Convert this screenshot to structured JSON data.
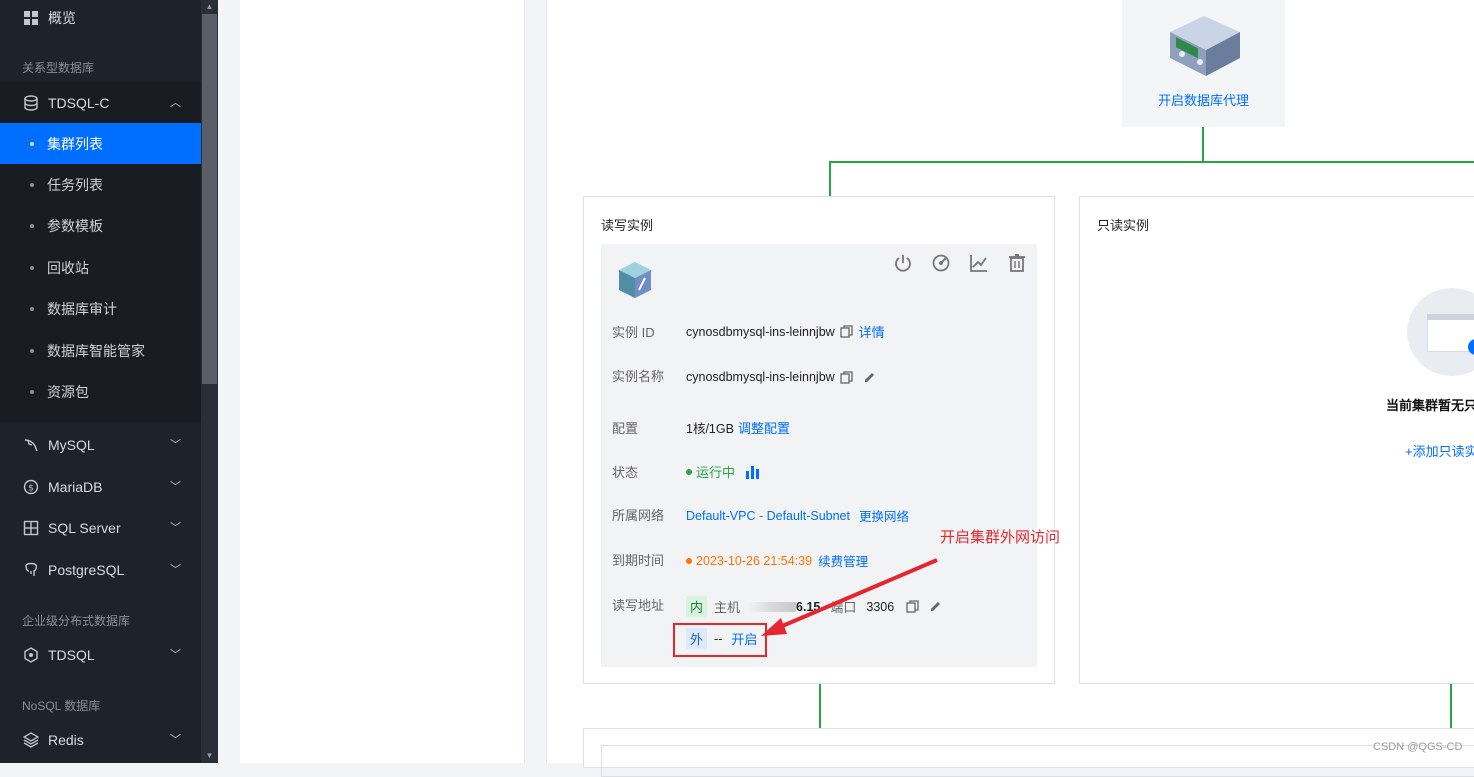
{
  "sidebar": {
    "overview": "概览",
    "section_relational": "关系型数据库",
    "tdsqlc": "TDSQL-C",
    "tdsqlc_items": [
      "集群列表",
      "任务列表",
      "参数模板",
      "回收站",
      "数据库审计",
      "数据库智能管家",
      "资源包"
    ],
    "mysql": "MySQL",
    "mariadb": "MariaDB",
    "sqlserver": "SQL Server",
    "postgresql": "PostgreSQL",
    "section_enterprise": "企业级分布式数据库",
    "tdsql": "TDSQL",
    "section_nosql": "NoSQL 数据库",
    "redis": "Redis"
  },
  "proxy": {
    "label": "开启数据库代理"
  },
  "rw": {
    "title": "读写实例",
    "id_label": "实例 ID",
    "id_value": "cynosdbmysql-ins-leinnjbw",
    "details_link": "详情",
    "name_label": "实例名称",
    "name_value": "cynosdbmysql-ins-leinnjbw",
    "config_label": "配置",
    "config_value": "1核/1GB",
    "config_link": "调整配置",
    "status_label": "状态",
    "status_value": "运行中",
    "network_label": "所属网络",
    "vpc": "Default-VPC",
    "sep": " - ",
    "subnet": "Default-Subnet",
    "change_network": "更换网络",
    "expire_label": "到期时间",
    "expire_value": "2023-10-26 21:54:39",
    "renew_link": "续费管理",
    "addr_label": "读写地址",
    "inner_tag": "内",
    "host_label": "主机",
    "host_value": "6.15",
    "port_label": "端口",
    "port_value": "3306",
    "outer_tag": "外",
    "outer_value": "--",
    "enable_link": "开启"
  },
  "ro": {
    "title": "只读实例",
    "empty_text": "当前集群暂无只",
    "add_link": "+添加只读实"
  },
  "annotation": {
    "text": "开启集群外网访问"
  },
  "watermark": "CSDN @QGS-CD",
  "colors": {
    "accent": "#006eff",
    "green": "#29a445",
    "orange": "#ff7200",
    "red": "#e3262f",
    "sidebar": "#1e222b"
  }
}
